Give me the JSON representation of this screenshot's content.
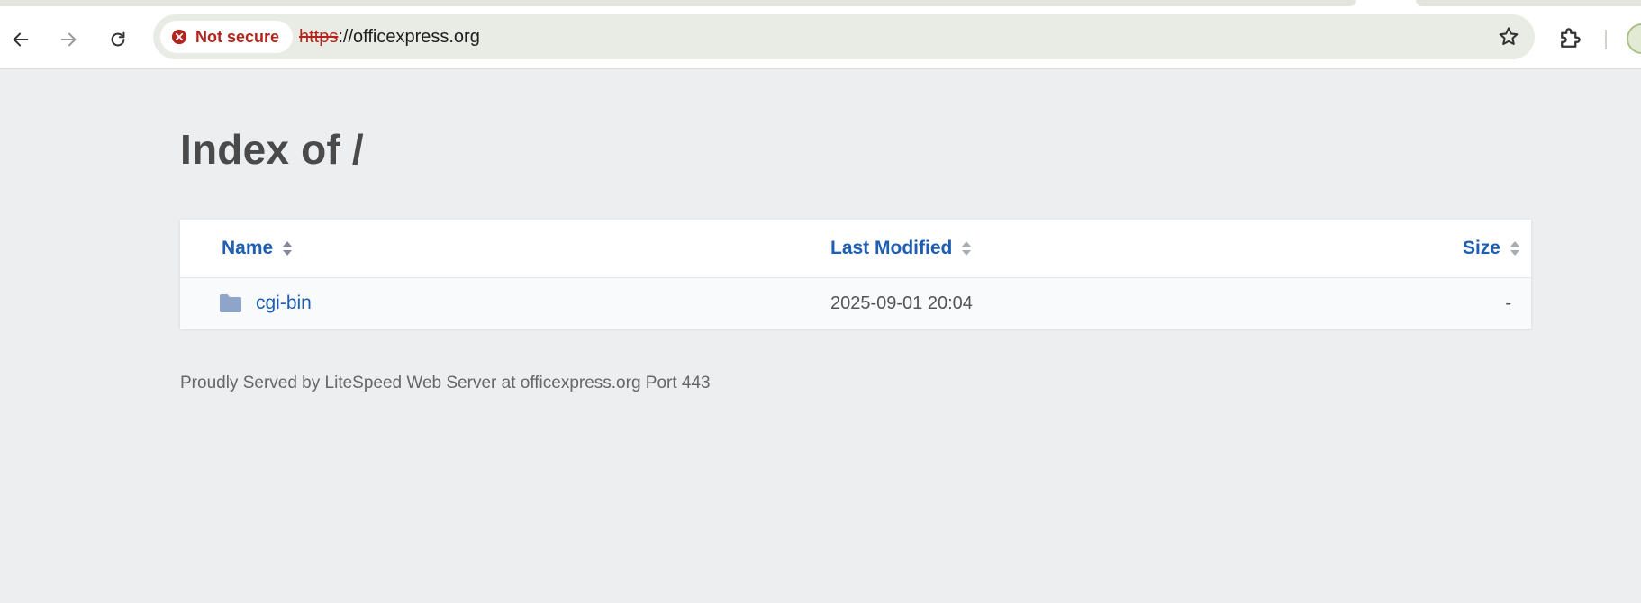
{
  "browser": {
    "security_chip_label": "Not secure",
    "url_scheme": "https",
    "url_rest": "://officexpress.org",
    "colors": {
      "warning_red": "#b3261e",
      "omnibox_bg": "#e9ebe5"
    },
    "icons": [
      "back-arrow-icon",
      "forward-arrow-icon",
      "reload-icon",
      "error-circle-icon",
      "bookmark-star-icon",
      "extensions-puzzle-icon",
      "profile-avatar"
    ]
  },
  "page": {
    "title": "Index of /",
    "columns": {
      "name": "Name",
      "last_modified": "Last Modified",
      "size": "Size"
    },
    "rows": [
      {
        "name": "cgi-bin",
        "icon": "folder-icon",
        "last_modified": "2025-09-01 20:04",
        "size": "-"
      }
    ],
    "footer": "Proudly Served by LiteSpeed Web Server at officexpress.org Port 443",
    "colors": {
      "link_blue": "#1f5fb3",
      "folder_icon": "#8ea4c8",
      "page_bg": "#eceef0"
    }
  }
}
